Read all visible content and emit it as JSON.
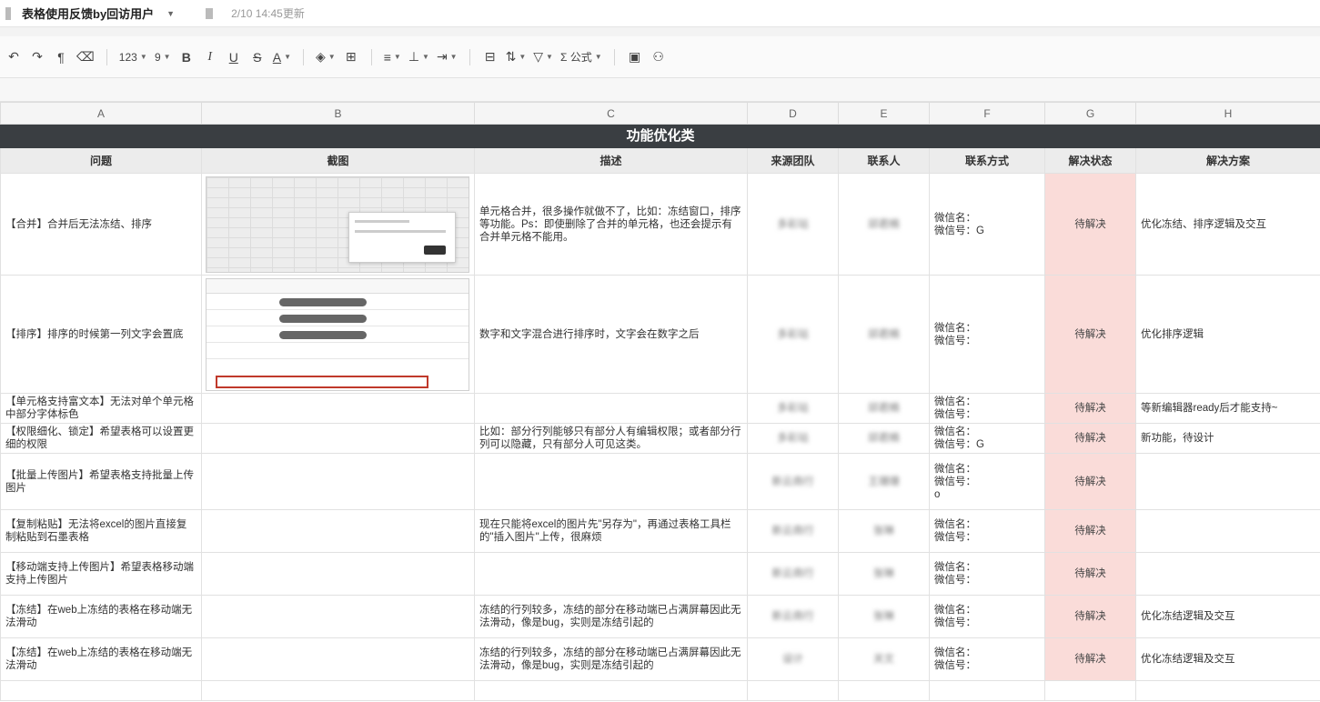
{
  "header": {
    "title": "表格使用反馈by回访用户",
    "updated": "2/10 14:45更新"
  },
  "toolbar": {
    "number_format": "123",
    "font_size": "9",
    "bold": "B",
    "italic": "I",
    "underline": "U",
    "strike": "S",
    "font_color": "A",
    "formula": "Σ 公式"
  },
  "columns": [
    "A",
    "B",
    "C",
    "D",
    "E",
    "F",
    "G",
    "H"
  ],
  "section_title": "功能优化类",
  "headers": [
    "问题",
    "截图",
    "描述",
    "来源团队",
    "联系人",
    "联系方式",
    "解决状态",
    "解决方案"
  ],
  "rows": [
    {
      "issue": "【合并】合并后无法冻结、排序",
      "desc": "单元格合并，很多操作就做不了，比如：冻结窗口，排序等功能。Ps：即使删除了合并的单元格，也还会提示有合并单元格不能用。",
      "team": "多彩站",
      "contact": "邱君楠",
      "contact_info": [
        "微信名：",
        "微信号：G"
      ],
      "status": "待解决",
      "solution": "优化冻结、排序逻辑及交互"
    },
    {
      "issue": "【排序】排序的时候第一列文字会置底",
      "desc": "数字和文字混合进行排序时，文字会在数字之后",
      "team": "多彩站",
      "contact": "邱君楠",
      "contact_info": [
        "微信名：",
        "微信号："
      ],
      "status": "待解决",
      "solution": "优化排序逻辑"
    },
    {
      "issue": "【单元格支持富文本】无法对单个单元格中部分字体标色",
      "desc": "",
      "team": "多彩站",
      "contact": "邱君楠",
      "contact_info": [
        "微信名：",
        "微信号："
      ],
      "status": "待解决",
      "solution": "等新编辑器ready后才能支持~"
    },
    {
      "issue": "【权限细化、锁定】希望表格可以设置更细的权限",
      "desc": "比如：部分行列能够只有部分人有编辑权限；或者部分行列可以隐藏，只有部分人可见这类。",
      "team": "多彩站",
      "contact": "邱君楠",
      "contact_info": [
        "微信名：",
        "微信号：G"
      ],
      "status": "待解决",
      "solution": "新功能，待设计"
    },
    {
      "issue": "【批量上传图片】希望表格支持批量上传图片",
      "desc": "",
      "team": "新云商行",
      "contact": "王珊珊",
      "contact_info": [
        "微信名：",
        "微信号：",
        "o"
      ],
      "status": "待解决",
      "solution": ""
    },
    {
      "issue": "【复制粘贴】无法将excel的图片直接复制粘贴到石墨表格",
      "desc": "现在只能将excel的图片先\"另存为\"，再通过表格工具栏的\"插入图片\"上传，很麻烦",
      "team": "新云商行",
      "contact": "张琳",
      "contact_info": [
        "微信名：",
        "微信号："
      ],
      "status": "待解决",
      "solution": ""
    },
    {
      "issue": "【移动端支持上传图片】希望表格移动端支持上传图片",
      "desc": "",
      "team": "新云商行",
      "contact": "张琳",
      "contact_info": [
        "微信名：",
        "微信号："
      ],
      "status": "待解决",
      "solution": ""
    },
    {
      "issue": "【冻结】在web上冻结的表格在移动端无法滑动",
      "desc": "冻结的行列较多，冻结的部分在移动端已占满屏幕因此无法滑动，像是bug，实则是冻结引起的",
      "team": "新云商行",
      "contact": "张琳",
      "contact_info": [
        "微信名：",
        "微信号："
      ],
      "status": "待解决",
      "solution": "优化冻结逻辑及交互"
    },
    {
      "issue": "【冻结】在web上冻结的表格在移动端无法滑动",
      "desc": "冻结的行列较多，冻结的部分在移动端已占满屏幕因此无法滑动，像是bug，实则是冻结引起的",
      "team": "设计",
      "contact": "关文",
      "contact_info": [
        "微信名：",
        "微信号："
      ],
      "status": "待解决",
      "solution": "优化冻结逻辑及交互"
    }
  ],
  "colors": {
    "section_bg": "#3a3e42",
    "status_bg": "#fadcd9",
    "header_bg": "#ececec"
  }
}
